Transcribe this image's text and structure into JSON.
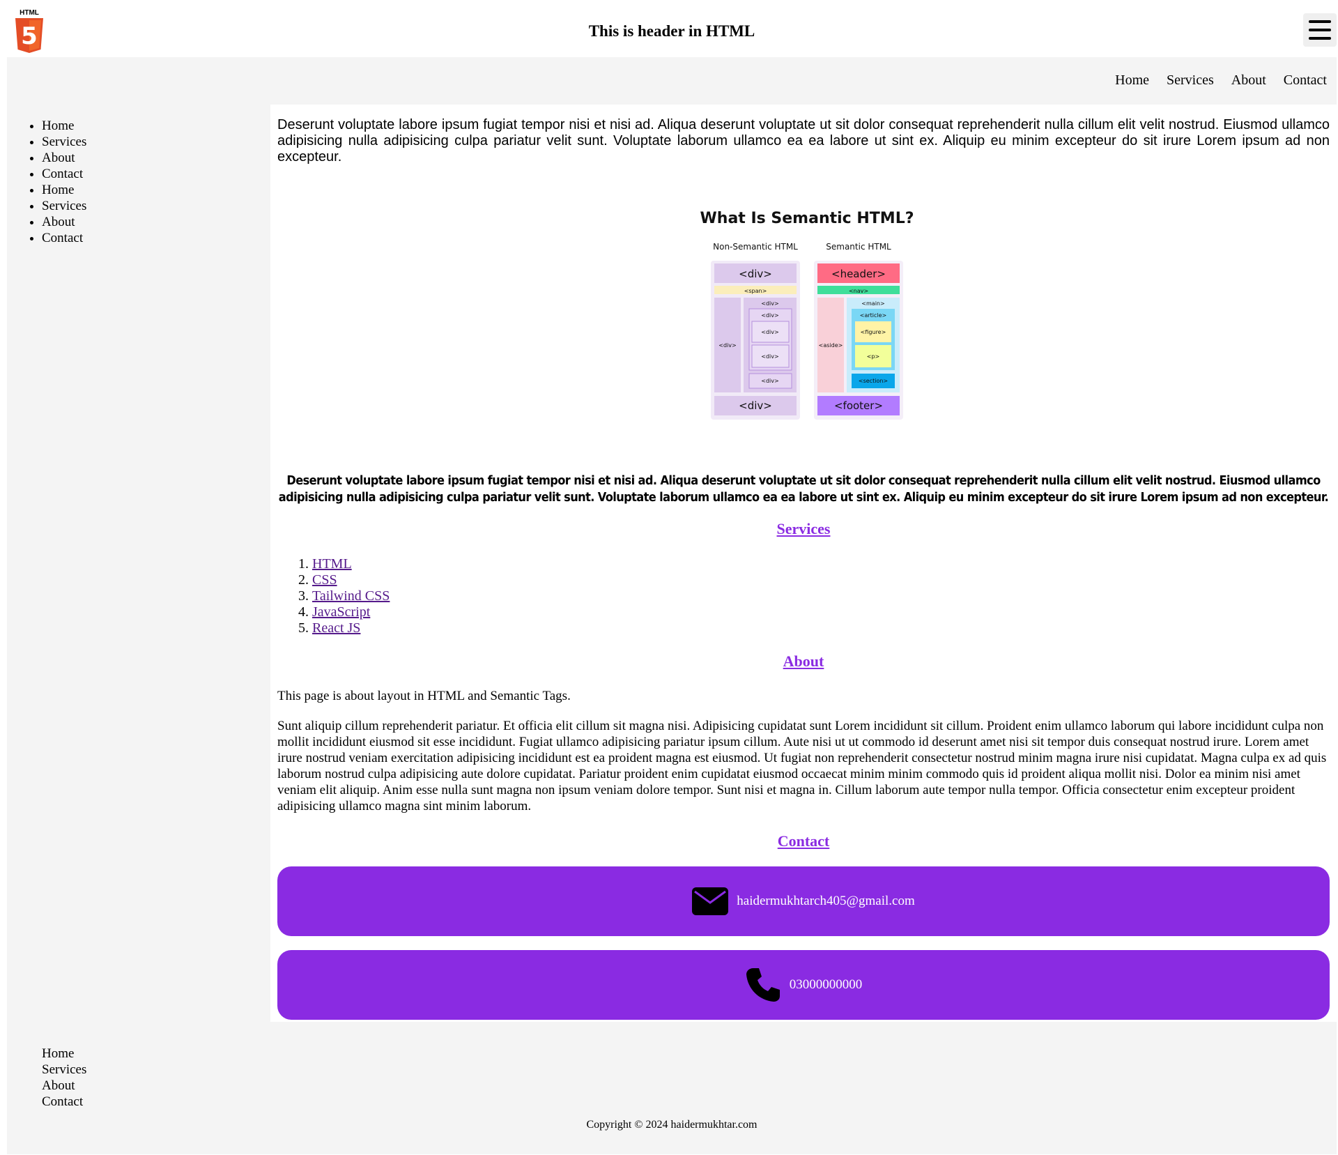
{
  "header": {
    "logo_text": "HTML",
    "logo_digit": "5",
    "title": "This is header in HTML"
  },
  "nav": [
    "Home",
    "Services",
    "About",
    "Contact"
  ],
  "sidebar": [
    "Home",
    "Services",
    "About",
    "Contact",
    "Home",
    "Services",
    "About",
    "Contact"
  ],
  "main": {
    "intro": "Deserunt voluptate labore ipsum fugiat tempor nisi et nisi ad. Aliqua deserunt voluptate ut sit dolor consequat reprehenderit nulla cillum elit velit nostrud. Eiusmod ullamco adipisicing nulla adipisicing culpa pariatur velit sunt. Voluptate laborum ullamco ea ea labore ut sint ex. Aliquip eu minim excepteur do sit irure Lorem ipsum ad non excepteur.",
    "figure": {
      "title": "What Is Semantic HTML?",
      "left_caption": "Non-Semantic HTML",
      "right_caption": "Semantic HTML",
      "tags": {
        "div": "<div>",
        "span": "<span>",
        "header": "<header>",
        "nav": "<nav>",
        "main": "<main>",
        "article": "<article>",
        "figure": "<figure>",
        "p": "<p>",
        "section": "<section>",
        "aside": "<aside>",
        "footer": "<footer>"
      }
    },
    "bold_paragraph": "Deserunt voluptate labore ipsum fugiat tempor nisi et nisi ad. Aliqua deserunt voluptate ut sit dolor consequat reprehenderit nulla cillum elit velit nostrud. Eiusmod ullamco adipisicing nulla adipisicing culpa pariatur velit sunt. Voluptate laborum ullamco ea ea labore ut sint ex. Aliquip eu minim excepteur do sit irure Lorem ipsum ad non excepteur.",
    "services_heading": "Services",
    "services": [
      "HTML",
      "CSS",
      "Tailwind CSS",
      "JavaScript",
      "React JS"
    ],
    "about_heading": "About",
    "about_intro": "This page is about layout in HTML and Semantic Tags.",
    "about_body": "Sunt aliquip cillum reprehenderit pariatur. Et officia elit cillum sit magna nisi. Adipisicing cupidatat sunt Lorem incididunt sit cillum. Proident enim ullamco laborum qui labore incididunt culpa non mollit incididunt eiusmod sit esse incididunt. Fugiat ullamco adipisicing pariatur ipsum cillum. Aute nisi ut ut commodo id deserunt amet nisi sit tempor duis consequat nostrud irure. Lorem amet irure nostrud veniam exercitation adipisicing incididunt est ea proident magna est eiusmod. Ut fugiat non reprehenderit consectetur nostrud minim magna irure nisi cupidatat. Magna culpa ex ad quis laborum nostrud culpa adipisicing aute dolore cupidatat. Pariatur proident enim cupidatat eiusmod occaecat minim minim commodo quis id proident aliqua mollit nisi. Dolor ea minim nisi amet veniam elit aliquip. Anim esse nulla sunt magna non ipsum veniam dolore tempor. Sunt nisi et magna in. Cillum laborum aute tempor nulla tempor. Officia consectetur enim excepteur proident adipisicing ullamco magna sint minim laborum.",
    "contact_heading": "Contact",
    "email": "haidermukhtarch405@gmail.com",
    "phone": "03000000000"
  },
  "footer": {
    "links": [
      "Home",
      "Services",
      "About",
      "Contact"
    ],
    "copyright": "Copyright © 2024 haidermukhtar.com"
  },
  "colors": {
    "accent": "#8a2be2",
    "panel_bg": "#f4f4f4",
    "html5_orange": "#e44d26",
    "html5_light": "#f16529"
  },
  "icons": [
    "html5-logo-icon",
    "hamburger-menu-icon",
    "envelope-icon",
    "phone-icon"
  ]
}
